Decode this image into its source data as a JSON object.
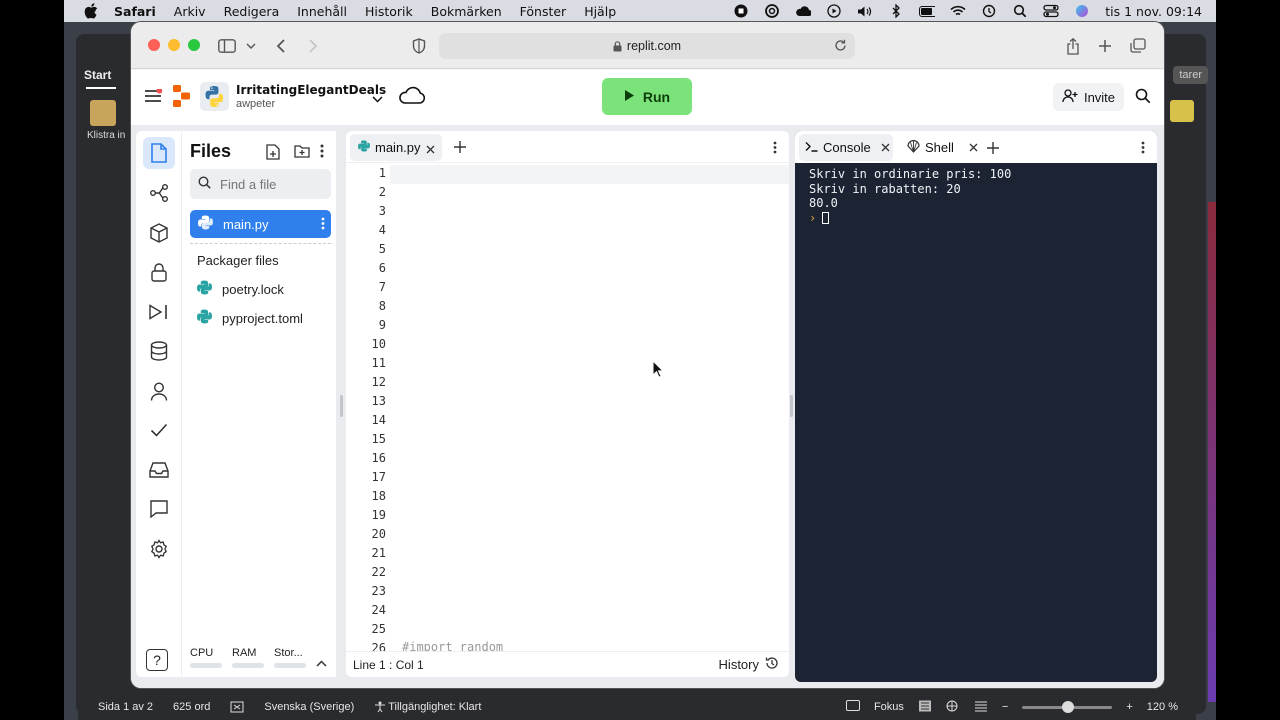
{
  "menubar": {
    "app": "Safari",
    "items": [
      "Arkiv",
      "Redigera",
      "Innehåll",
      "Historik",
      "Bokmärken",
      "Fönster",
      "Hjälp"
    ],
    "clock": "tis 1 nov.  09:14"
  },
  "background_app": {
    "tab": "Start",
    "paste_label": "Klistra in",
    "right_label": "tarer",
    "status": {
      "page": "Sida 1 av 2",
      "words": "625 ord",
      "language": "Svenska (Sverige)",
      "accessibility": "Tillgänglighet: Klart",
      "focus": "Fokus",
      "zoom": "120 %",
      "zoom_level": 1.2
    }
  },
  "browser": {
    "url": "replit.com"
  },
  "replit": {
    "repl_name": "IrritatingElegantDeals",
    "user": "awpeter",
    "run_label": "Run",
    "invite_label": "Invite",
    "files_title": "Files",
    "search_placeholder": "Find a file",
    "active_file": "main.py",
    "packager_title": "Packager files",
    "packager_files": [
      "poetry.lock",
      "pyproject.toml"
    ],
    "resources": [
      "CPU",
      "RAM",
      "Stor..."
    ],
    "help_label": "?",
    "editor": {
      "tab": "main.py",
      "line_numbers": [
        "1",
        "2",
        "3",
        "4",
        "5",
        "6",
        "7",
        "8",
        "9",
        "10",
        "11",
        "12",
        "13",
        "14",
        "15",
        "16",
        "17",
        "18",
        "19",
        "20",
        "21",
        "22",
        "23",
        "24",
        "25",
        "26"
      ],
      "visible_code": "#import random",
      "status": "Line 1 : Col 1",
      "history_label": "History"
    },
    "console": {
      "tabs": [
        "Console",
        "Shell"
      ],
      "lines": [
        "Skriv in ordinarie pris: 100",
        "Skriv in rabatten: 20",
        "80.0"
      ],
      "prompt": "›"
    }
  },
  "colors": {
    "run": "#7ce37a",
    "active_file": "#2f7fec",
    "console_bg": "#1c2333",
    "prompt": "#e3a33d"
  }
}
